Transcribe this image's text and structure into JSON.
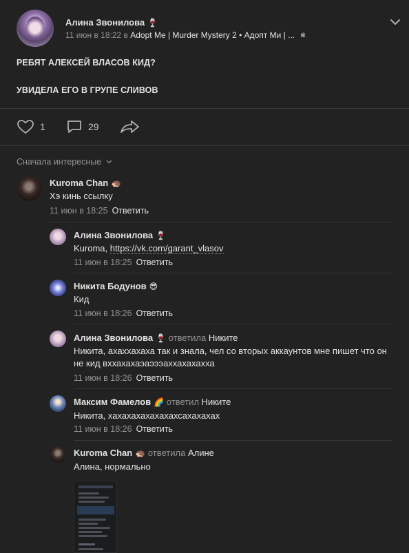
{
  "post": {
    "author": "Алина Звонилова",
    "author_emoji": "🍷",
    "date": "11 июн в 18:22 в",
    "group": "Adopt Me | Murder Mystery 2 • Адопт Ми | ...",
    "lines": [
      "РЕБЯТ АЛЕКСЕЙ ВЛАСОВ КИД?",
      "УВИДЕЛА ЕГО В ГРУПЕ СЛИВОВ"
    ],
    "likes": "1",
    "comments": "29"
  },
  "sort_label": "Сначала интересные",
  "comments": [
    {
      "name": "Kuroma Chan",
      "emoji": "🦔",
      "reply_word": "",
      "reply_to": "",
      "text": "Хэ кинь ссылку",
      "link": "",
      "date": "11 июн в 18:25",
      "reply": "Ответить"
    },
    {
      "name": "Алина Звонилова",
      "emoji": "🍷",
      "reply_word": "",
      "reply_to": "",
      "text": "Kuroma,",
      "link": "https://vk.com/garant_vlasov",
      "date": "11 июн в 18:25",
      "reply": "Ответить"
    },
    {
      "name": "Никита Бодунов",
      "emoji": "😎",
      "reply_word": "",
      "reply_to": "",
      "text": "Кид",
      "link": "",
      "date": "11 июн в 18:26",
      "reply": "Ответить"
    },
    {
      "name": "Алина Звонилова",
      "emoji": "🍷",
      "reply_word": "ответила",
      "reply_to": "Никите",
      "text": "Никита, ахаххахаха так и знала, чел со вторых аккаунтов мне пишет что он не кид вххахахаэаэээаххахахахха",
      "link": "",
      "date": "11 июн в 18:26",
      "reply": "Ответить"
    },
    {
      "name": "Максим Фамелов",
      "emoji": "🌈",
      "reply_word": "ответил",
      "reply_to": "Никите",
      "text": "Никита, хахахахахахахахсахахахах",
      "link": "",
      "date": "11 июн в 18:26",
      "reply": "Ответить"
    },
    {
      "name": "Kuroma Chan",
      "emoji": "🦔",
      "reply_word": "ответила",
      "reply_to": "Алине",
      "text": "Алина, нормально",
      "link": "",
      "date": "",
      "reply": ""
    }
  ],
  "colors": {
    "background": "#222222",
    "text": "#e1e3e6",
    "muted": "#939393",
    "divider": "#363738"
  },
  "icons": [
    "heart-icon",
    "comment-icon",
    "share-icon",
    "chevron-down-icon",
    "apple-icon"
  ]
}
